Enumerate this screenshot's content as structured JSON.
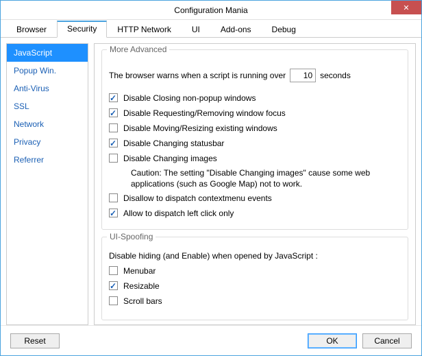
{
  "window": {
    "title": "Configuration Mania"
  },
  "tabs": [
    {
      "label": "Browser"
    },
    {
      "label": "Security"
    },
    {
      "label": "HTTP Network"
    },
    {
      "label": "UI"
    },
    {
      "label": "Add-ons"
    },
    {
      "label": "Debug"
    }
  ],
  "sidebar": {
    "items": [
      {
        "label": "JavaScript"
      },
      {
        "label": "Popup Win."
      },
      {
        "label": "Anti-Virus"
      },
      {
        "label": "SSL"
      },
      {
        "label": "Network"
      },
      {
        "label": "Privacy"
      },
      {
        "label": "Referrer"
      }
    ]
  },
  "sections": {
    "moreAdvanced": {
      "legend": "More Advanced",
      "warnRow": {
        "pre": "The browser warns when a script is running over",
        "value": "10",
        "post": "seconds"
      },
      "checks": [
        {
          "label": "Disable Closing non-popup windows",
          "checked": true
        },
        {
          "label": "Disable Requesting/Removing window focus",
          "checked": true
        },
        {
          "label": "Disable Moving/Resizing existing windows",
          "checked": false
        },
        {
          "label": "Disable Changing statusbar",
          "checked": true
        },
        {
          "label": "Disable Changing images",
          "checked": false,
          "note": "Caution: The setting \"Disable Changing images\" cause some web applications (such as Google Map) not to work."
        },
        {
          "label": "Disallow to dispatch contextmenu events",
          "checked": false
        },
        {
          "label": "Allow to dispatch left click only",
          "checked": true
        }
      ]
    },
    "uiSpoofing": {
      "legend": "UI-Spoofing",
      "subtext": "Disable hiding (and Enable) when opened by JavaScript :",
      "checks": [
        {
          "label": "Menubar",
          "checked": false
        },
        {
          "label": "Resizable",
          "checked": true
        },
        {
          "label": "Scroll bars",
          "checked": false
        }
      ]
    }
  },
  "footer": {
    "reset": "Reset",
    "ok": "OK",
    "cancel": "Cancel"
  }
}
